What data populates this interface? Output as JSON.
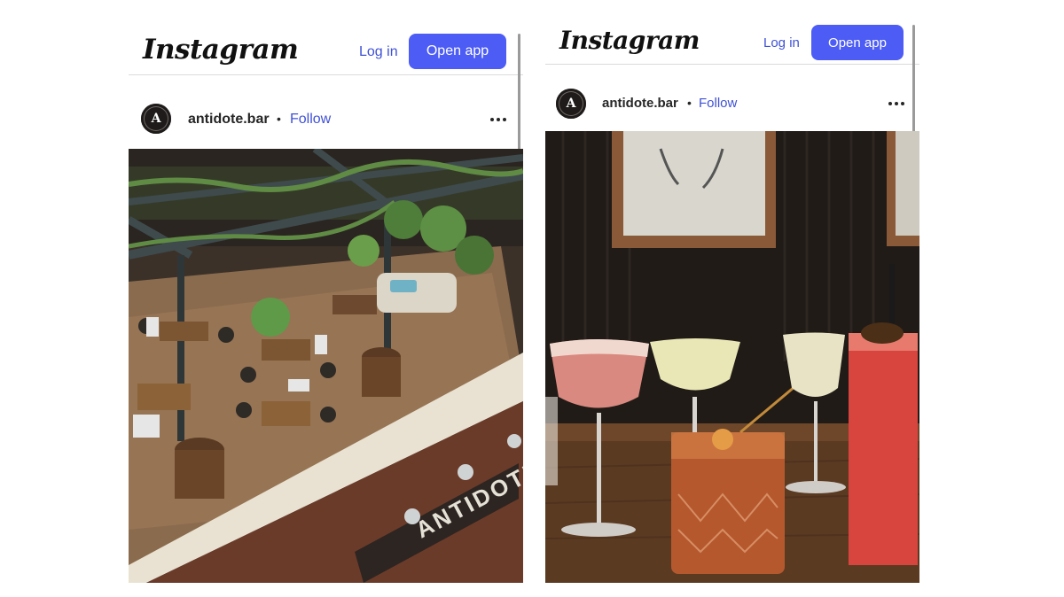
{
  "left_post": {
    "header": {
      "logo_text": "Instagram",
      "login_label": "Log in",
      "open_app_label": "Open app"
    },
    "post": {
      "avatar_letter": "A",
      "username": "antidote.bar",
      "separator": "•",
      "follow_label": "Follow",
      "image_alt": "Rooftop patio of Antidote bar with tables, chairs and plants",
      "building_sign_text": "ANTIDOTE"
    }
  },
  "right_post": {
    "header": {
      "logo_text": "Instagram",
      "login_label": "Log in",
      "open_app_label": "Open app"
    },
    "post": {
      "avatar_letter": "A",
      "username": "antidote.bar",
      "separator": "•",
      "follow_label": "Follow",
      "image_alt": "Assorted cocktails on a wooden bar table"
    }
  },
  "colors": {
    "link_blue": "#3f51d6",
    "button_blue": "#4c5cf5",
    "divider": "#dbdbdb"
  },
  "icons": [
    "more-options-icon",
    "avatar-logo"
  ]
}
